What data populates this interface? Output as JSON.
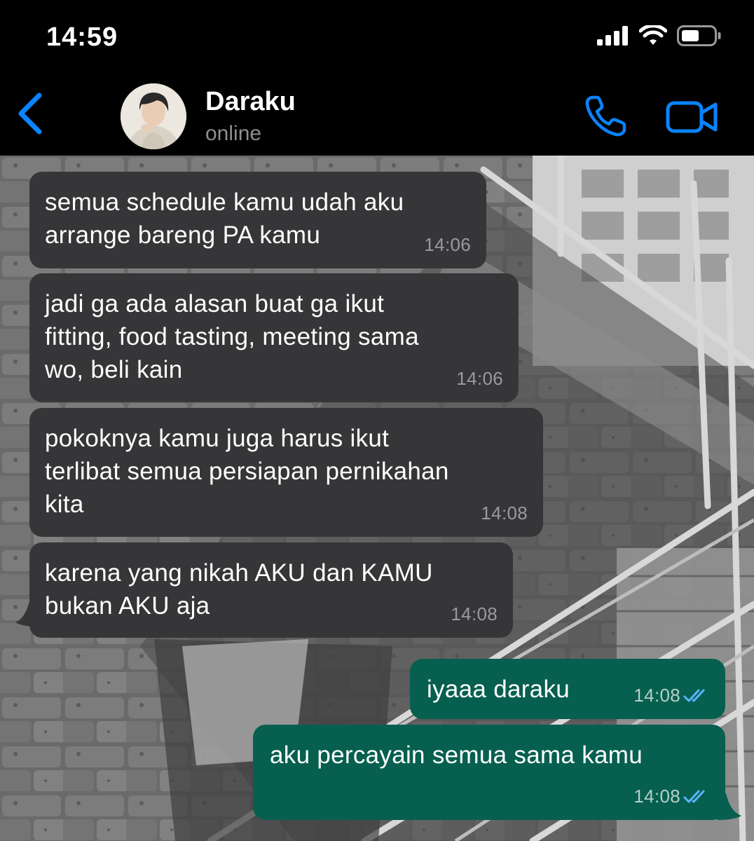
{
  "status_bar": {
    "time": "14:59"
  },
  "header": {
    "back_icon": "chevron-left-icon",
    "contact_name": "Daraku",
    "contact_status": "online",
    "call_icon": "phone-icon",
    "video_icon": "video-camera-icon",
    "accent_color": "#0a84ff"
  },
  "messages": [
    {
      "direction": "in",
      "text": "semua schedule kamu udah aku\narrange bareng PA kamu",
      "time": "14:06"
    },
    {
      "direction": "in",
      "text": "jadi ga ada alasan buat ga ikut\nfitting, food tasting, meeting sama\nwo, beli kain",
      "time": "14:06"
    },
    {
      "direction": "in",
      "text": "pokoknya kamu juga harus ikut\nterlibat semua persiapan pernikahan\nkita",
      "time": "14:08"
    },
    {
      "direction": "in",
      "text": "karena yang nikah AKU dan KAMU\nbukan AKU aja",
      "time": "14:08"
    },
    {
      "direction": "out",
      "text": "iyaaa daraku",
      "time": "14:08",
      "status": "read"
    },
    {
      "direction": "out",
      "text": "aku percayain semua sama kamu",
      "time": "14:08",
      "status": "read"
    }
  ],
  "colors": {
    "incoming_bubble": "#363638",
    "outgoing_bubble": "#075f4f",
    "read_ticks": "#5ab4ff"
  }
}
